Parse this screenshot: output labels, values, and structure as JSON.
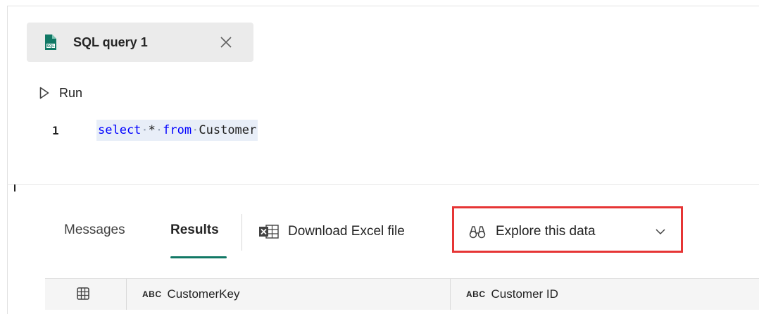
{
  "editor_tab": {
    "title": "SQL query 1",
    "icon": "sql-file-icon",
    "close_icon": "close-icon"
  },
  "toolbar": {
    "run_label": "Run",
    "run_icon": "play-icon"
  },
  "editor": {
    "line_number": "1",
    "code_tokens": [
      "select",
      "*",
      "from",
      "Customer"
    ]
  },
  "results_toolbar": {
    "tabs": [
      {
        "label": "Messages",
        "selected": false
      },
      {
        "label": "Results",
        "selected": true
      }
    ],
    "download_label": "Download Excel file",
    "download_icon": "excel-icon",
    "explore_label": "Explore this data",
    "explore_icon": "binoculars-icon",
    "explore_chevron": "chevron-down-icon",
    "highlight_color": "#e63535",
    "accent_color": "#117865"
  },
  "grid": {
    "corner_icon": "table-icon",
    "columns": [
      {
        "type": "ABC",
        "name": "CustomerKey"
      },
      {
        "type": "ABC",
        "name": "Customer ID"
      }
    ]
  }
}
